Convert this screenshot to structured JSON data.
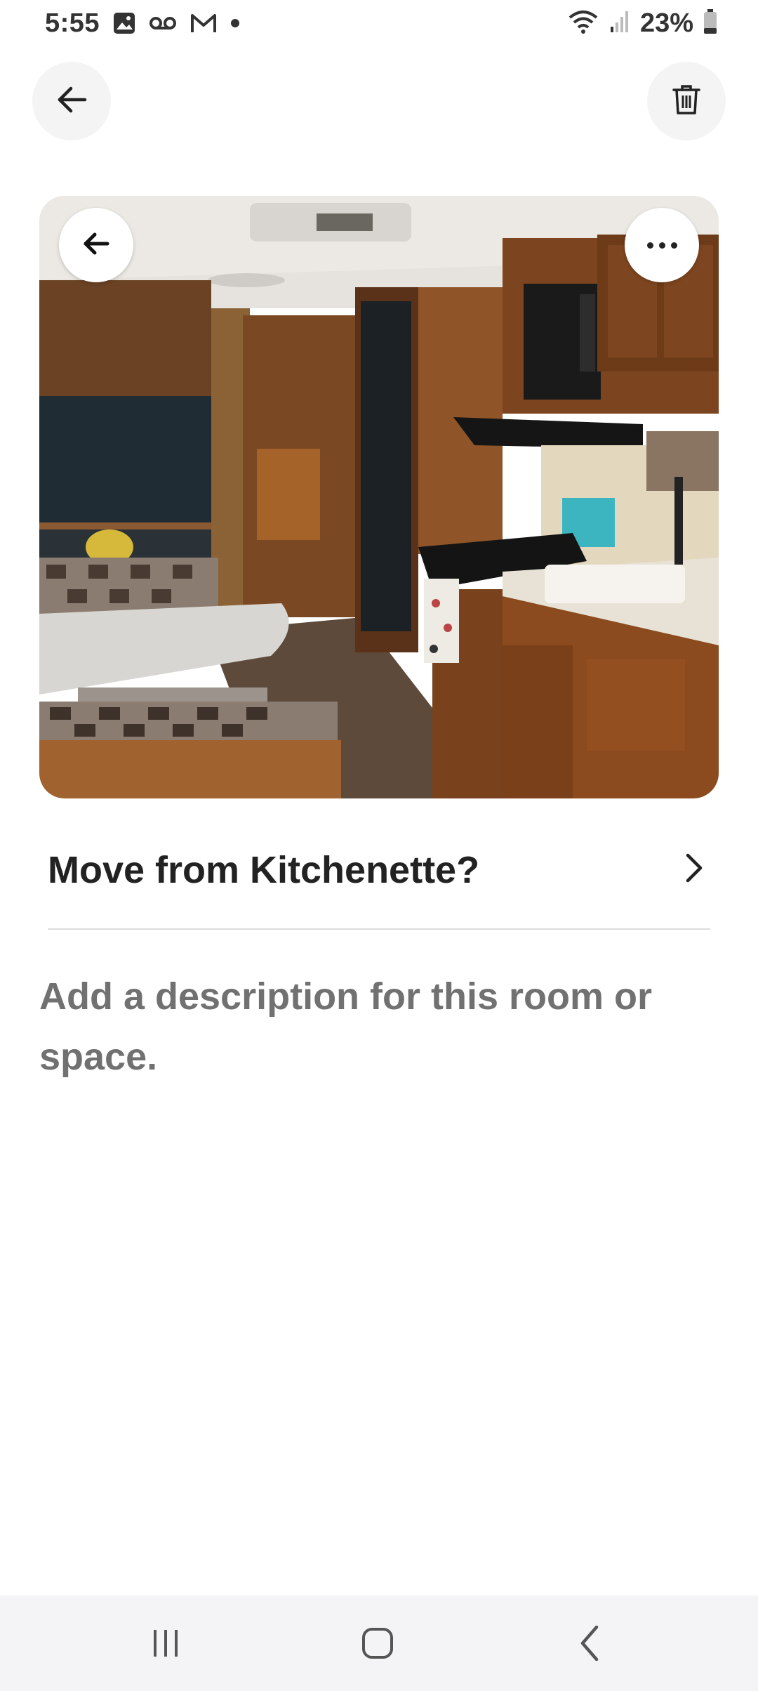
{
  "status_bar": {
    "time": "5:55",
    "battery_percent": "23%",
    "left_icons": [
      "gallery-icon",
      "voicemail-icon",
      "gmail-icon",
      "dot-icon"
    ],
    "right_icons": [
      "wifi-icon",
      "signal-icon",
      "battery-icon"
    ],
    "battery_level": 0.23
  },
  "header": {
    "back_icon": "arrow-left-icon",
    "delete_icon": "trash-icon"
  },
  "photo": {
    "subject": "",
    "overlay_back_icon": "arrow-left-icon",
    "overlay_more_icon": "more-horizontal-icon"
  },
  "room": {
    "title": "Move from Kitchenette?",
    "chevron_icon": "chevron-right-icon"
  },
  "description_placeholder": "Add a description for this room or space.",
  "nav_bar": {
    "items": [
      "recent-apps-icon",
      "home-icon",
      "back-icon"
    ]
  },
  "colors": {
    "title": "#222222",
    "placeholder": "#717171",
    "button_bg": "#f4f4f4",
    "divider": "#dddddd"
  }
}
